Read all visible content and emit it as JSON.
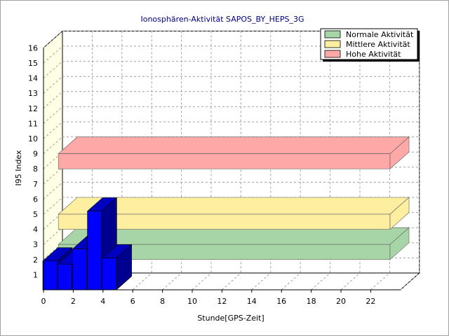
{
  "chart_data": {
    "type": "bar",
    "title": "Ionosphären-Aktivität SAPOS_BY_HEPS_3G",
    "xlabel": "Stunde[GPS-Zeit]",
    "ylabel": "I95 Index",
    "x": [
      0,
      1,
      2,
      3,
      4
    ],
    "values": [
      1.9,
      1.7,
      2.7,
      5.2,
      2.1
    ],
    "xlim": [
      0,
      24
    ],
    "ylim": [
      0,
      16
    ],
    "x_ticks": [
      "0",
      "2",
      "4",
      "6",
      "8",
      "10",
      "12",
      "14",
      "16",
      "18",
      "20",
      "22"
    ],
    "y_ticks": [
      "1",
      "2",
      "3",
      "4",
      "5",
      "6",
      "7",
      "8",
      "9",
      "10",
      "11",
      "12",
      "13",
      "14",
      "15",
      "16"
    ],
    "bands": [
      {
        "name": "Normale Aktivität",
        "from": 2,
        "to": 3,
        "color": "#a8d5a8"
      },
      {
        "name": "Mittlere Aktivität",
        "from": 4,
        "to": 5,
        "color": "#fdeea0"
      },
      {
        "name": "Hohe Aktivität",
        "from": 8,
        "to": 9,
        "color": "#ffa8a8"
      }
    ],
    "legend_position": "top-right",
    "grid": true,
    "bar_color": "#0000ff"
  }
}
